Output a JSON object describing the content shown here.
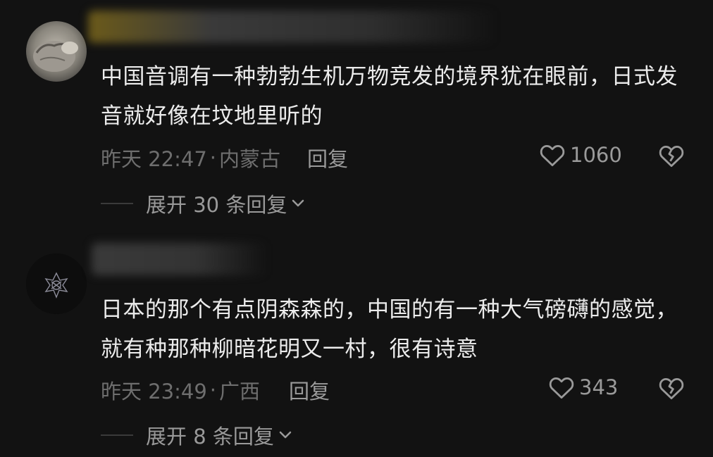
{
  "comments": [
    {
      "text": "中国音调有一种勃勃生机万物竞发的境界犹在眼前，日式发音就好像在坟地里听的",
      "time": "昨天 22:47",
      "dot": "·",
      "location": "内蒙古",
      "reply_label": "回复",
      "likes": "1060",
      "expand_label": "展开 30 条回复",
      "avatar_icon": "cat-avatar-icon"
    },
    {
      "text": "日本的那个有点阴森森的，中国的有一种大气磅礴的感觉，就有种那种柳暗花明又一村，很有诗意",
      "time": "昨天 23:49",
      "dot": "·",
      "location": "广西",
      "reply_label": "回复",
      "likes": "343",
      "expand_label": "展开 8 条回复",
      "avatar_icon": "dark-flower-avatar-icon"
    }
  ],
  "colors": {
    "background": "#121212",
    "text": "#ececec",
    "meta": "#6e6e6e",
    "action": "#9a9a9a"
  }
}
